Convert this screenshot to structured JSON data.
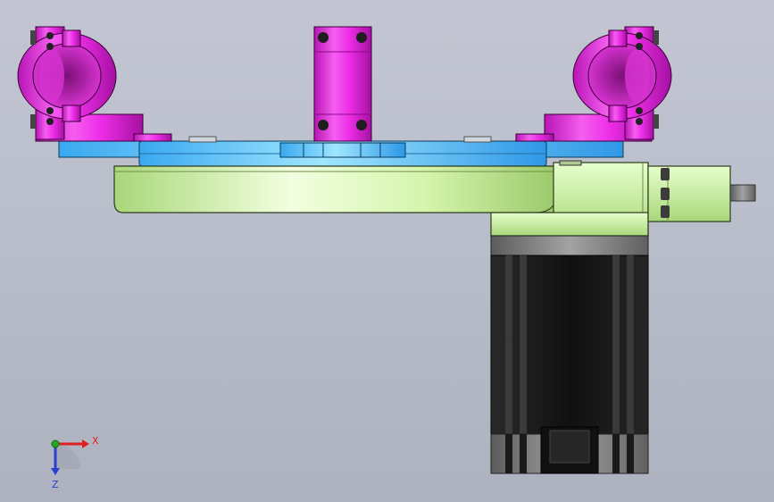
{
  "viewport": {
    "background_top": "#c3c6d2",
    "background_bottom": "#aeb2c0"
  },
  "colors": {
    "clamp_magenta": "#ee2ee8",
    "plate_cyan": "#5fc8ff",
    "base_green": "#c9ef9a",
    "motor_body": "#1c1c1c",
    "motor_gray": "#8a8a8a",
    "axis_x": "#e02020",
    "axis_y": "#22aa22",
    "axis_z": "#2a3fd0"
  },
  "triad": {
    "x_label": "X",
    "z_label": "Z"
  }
}
